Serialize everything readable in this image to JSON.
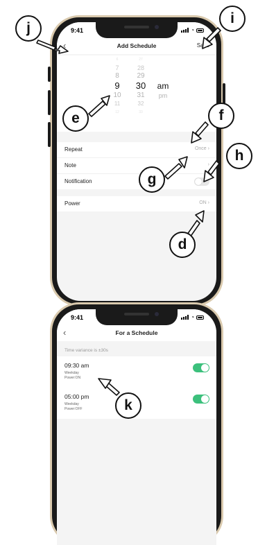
{
  "add_schedule": {
    "status_time": "9:41",
    "title": "Add Schedule",
    "back_glyph": "‹",
    "save_label": "Save",
    "picker": {
      "hours": [
        "6",
        "7",
        "8",
        "9",
        "10",
        "11",
        "12"
      ],
      "minutes": [
        "27",
        "28",
        "29",
        "30",
        "31",
        "32",
        "33"
      ],
      "selected_hour": "9",
      "selected_minute": "30",
      "periods": [
        "am",
        "pm"
      ],
      "selected_period": "am"
    },
    "rows": {
      "repeat": {
        "label": "Repeat",
        "value": "Once"
      },
      "note": {
        "label": "Note"
      },
      "notification": {
        "label": "Notification",
        "enabled": false
      },
      "power": {
        "label": "Power",
        "value": "ON"
      }
    }
  },
  "for_schedule": {
    "status_time": "9:41",
    "title": "For a Schedule",
    "back_glyph": "‹",
    "variance_text": "Time variance is ±30s",
    "items": [
      {
        "time": "09:30 am",
        "repeat": "Weekday",
        "power": "Power:ON",
        "enabled": true
      },
      {
        "time": "05:00 pm",
        "repeat": "Weekday",
        "power": "Power:OFF",
        "enabled": true
      }
    ]
  },
  "callouts": {
    "d": "d",
    "e": "e",
    "f": "f",
    "g": "g",
    "h": "h",
    "i": "i",
    "j": "j",
    "k": "k"
  },
  "colors": {
    "toggle_on": "#3cc07c",
    "frame": "#d9c9ad",
    "screen_bg": "#f4f4f4"
  }
}
